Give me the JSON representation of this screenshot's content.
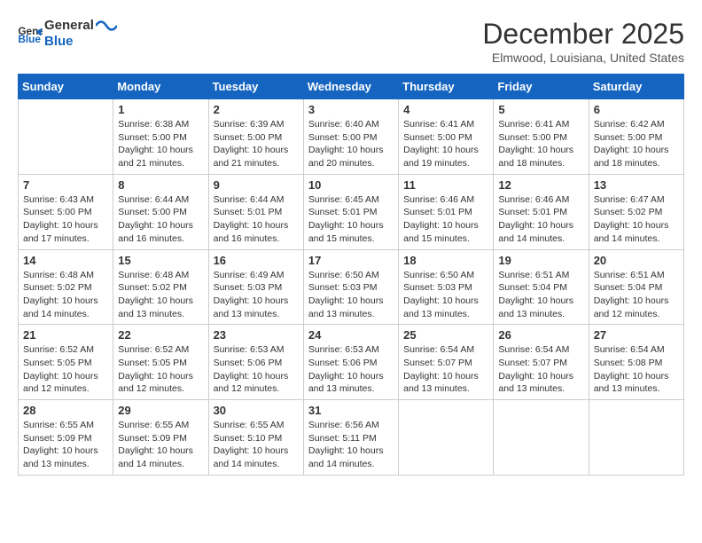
{
  "header": {
    "logo_line1": "General",
    "logo_line2": "Blue",
    "month": "December 2025",
    "location": "Elmwood, Louisiana, United States"
  },
  "weekdays": [
    "Sunday",
    "Monday",
    "Tuesday",
    "Wednesday",
    "Thursday",
    "Friday",
    "Saturday"
  ],
  "weeks": [
    [
      {
        "day": "",
        "info": ""
      },
      {
        "day": "1",
        "info": "Sunrise: 6:38 AM\nSunset: 5:00 PM\nDaylight: 10 hours\nand 21 minutes."
      },
      {
        "day": "2",
        "info": "Sunrise: 6:39 AM\nSunset: 5:00 PM\nDaylight: 10 hours\nand 21 minutes."
      },
      {
        "day": "3",
        "info": "Sunrise: 6:40 AM\nSunset: 5:00 PM\nDaylight: 10 hours\nand 20 minutes."
      },
      {
        "day": "4",
        "info": "Sunrise: 6:41 AM\nSunset: 5:00 PM\nDaylight: 10 hours\nand 19 minutes."
      },
      {
        "day": "5",
        "info": "Sunrise: 6:41 AM\nSunset: 5:00 PM\nDaylight: 10 hours\nand 18 minutes."
      },
      {
        "day": "6",
        "info": "Sunrise: 6:42 AM\nSunset: 5:00 PM\nDaylight: 10 hours\nand 18 minutes."
      }
    ],
    [
      {
        "day": "7",
        "info": "Sunrise: 6:43 AM\nSunset: 5:00 PM\nDaylight: 10 hours\nand 17 minutes."
      },
      {
        "day": "8",
        "info": "Sunrise: 6:44 AM\nSunset: 5:00 PM\nDaylight: 10 hours\nand 16 minutes."
      },
      {
        "day": "9",
        "info": "Sunrise: 6:44 AM\nSunset: 5:01 PM\nDaylight: 10 hours\nand 16 minutes."
      },
      {
        "day": "10",
        "info": "Sunrise: 6:45 AM\nSunset: 5:01 PM\nDaylight: 10 hours\nand 15 minutes."
      },
      {
        "day": "11",
        "info": "Sunrise: 6:46 AM\nSunset: 5:01 PM\nDaylight: 10 hours\nand 15 minutes."
      },
      {
        "day": "12",
        "info": "Sunrise: 6:46 AM\nSunset: 5:01 PM\nDaylight: 10 hours\nand 14 minutes."
      },
      {
        "day": "13",
        "info": "Sunrise: 6:47 AM\nSunset: 5:02 PM\nDaylight: 10 hours\nand 14 minutes."
      }
    ],
    [
      {
        "day": "14",
        "info": "Sunrise: 6:48 AM\nSunset: 5:02 PM\nDaylight: 10 hours\nand 14 minutes."
      },
      {
        "day": "15",
        "info": "Sunrise: 6:48 AM\nSunset: 5:02 PM\nDaylight: 10 hours\nand 13 minutes."
      },
      {
        "day": "16",
        "info": "Sunrise: 6:49 AM\nSunset: 5:03 PM\nDaylight: 10 hours\nand 13 minutes."
      },
      {
        "day": "17",
        "info": "Sunrise: 6:50 AM\nSunset: 5:03 PM\nDaylight: 10 hours\nand 13 minutes."
      },
      {
        "day": "18",
        "info": "Sunrise: 6:50 AM\nSunset: 5:03 PM\nDaylight: 10 hours\nand 13 minutes."
      },
      {
        "day": "19",
        "info": "Sunrise: 6:51 AM\nSunset: 5:04 PM\nDaylight: 10 hours\nand 13 minutes."
      },
      {
        "day": "20",
        "info": "Sunrise: 6:51 AM\nSunset: 5:04 PM\nDaylight: 10 hours\nand 12 minutes."
      }
    ],
    [
      {
        "day": "21",
        "info": "Sunrise: 6:52 AM\nSunset: 5:05 PM\nDaylight: 10 hours\nand 12 minutes."
      },
      {
        "day": "22",
        "info": "Sunrise: 6:52 AM\nSunset: 5:05 PM\nDaylight: 10 hours\nand 12 minutes."
      },
      {
        "day": "23",
        "info": "Sunrise: 6:53 AM\nSunset: 5:06 PM\nDaylight: 10 hours\nand 12 minutes."
      },
      {
        "day": "24",
        "info": "Sunrise: 6:53 AM\nSunset: 5:06 PM\nDaylight: 10 hours\nand 13 minutes."
      },
      {
        "day": "25",
        "info": "Sunrise: 6:54 AM\nSunset: 5:07 PM\nDaylight: 10 hours\nand 13 minutes."
      },
      {
        "day": "26",
        "info": "Sunrise: 6:54 AM\nSunset: 5:07 PM\nDaylight: 10 hours\nand 13 minutes."
      },
      {
        "day": "27",
        "info": "Sunrise: 6:54 AM\nSunset: 5:08 PM\nDaylight: 10 hours\nand 13 minutes."
      }
    ],
    [
      {
        "day": "28",
        "info": "Sunrise: 6:55 AM\nSunset: 5:09 PM\nDaylight: 10 hours\nand 13 minutes."
      },
      {
        "day": "29",
        "info": "Sunrise: 6:55 AM\nSunset: 5:09 PM\nDaylight: 10 hours\nand 14 minutes."
      },
      {
        "day": "30",
        "info": "Sunrise: 6:55 AM\nSunset: 5:10 PM\nDaylight: 10 hours\nand 14 minutes."
      },
      {
        "day": "31",
        "info": "Sunrise: 6:56 AM\nSunset: 5:11 PM\nDaylight: 10 hours\nand 14 minutes."
      },
      {
        "day": "",
        "info": ""
      },
      {
        "day": "",
        "info": ""
      },
      {
        "day": "",
        "info": ""
      }
    ]
  ]
}
